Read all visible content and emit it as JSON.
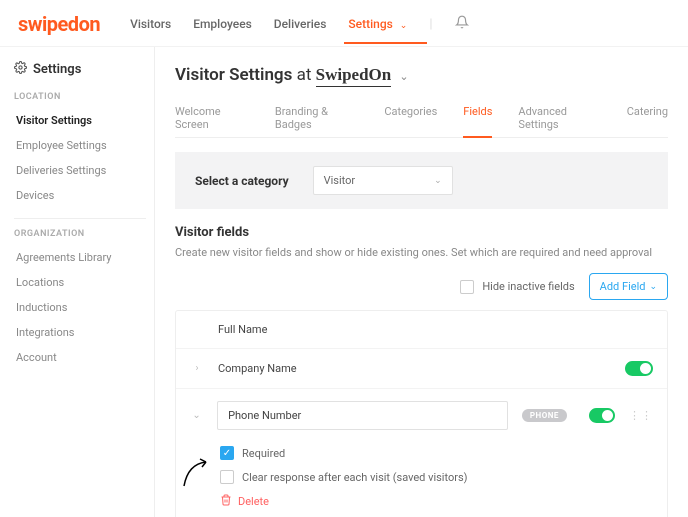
{
  "logo": "swipedon",
  "topnav": {
    "items": [
      "Visitors",
      "Employees",
      "Deliveries",
      "Settings"
    ],
    "activeIndex": 3
  },
  "sidebar": {
    "title": "Settings",
    "groups": {
      "location_label": "LOCATION",
      "location_items": [
        "Visitor Settings",
        "Employee Settings",
        "Deliveries Settings",
        "Devices"
      ],
      "location_active": 0,
      "org_label": "ORGANIZATION",
      "org_items": [
        "Agreements Library",
        "Locations",
        "Inductions",
        "Integrations",
        "Account"
      ]
    }
  },
  "page": {
    "title_prefix": "Visitor Settings",
    "title_at": "at",
    "title_brand": "SwipedOn"
  },
  "tabs": {
    "items": [
      "Welcome Screen",
      "Branding & Badges",
      "Categories",
      "Fields",
      "Advanced Settings",
      "Catering"
    ],
    "activeIndex": 3
  },
  "category": {
    "label": "Select a category",
    "value": "Visitor"
  },
  "section": {
    "heading": "Visitor fields",
    "sub": "Create new visitor fields and show or hide existing ones. Set which are required and need approval"
  },
  "toolbar": {
    "hide_label": "Hide inactive fields",
    "add_label": "Add Field"
  },
  "fields": {
    "row0_label": "Full Name",
    "row1_label": "Company Name",
    "row2_value": "Phone Number",
    "row2_pill": "PHONE",
    "required_label": "Required",
    "clear_label": "Clear response after each visit (saved visitors)",
    "delete_label": "Delete"
  }
}
